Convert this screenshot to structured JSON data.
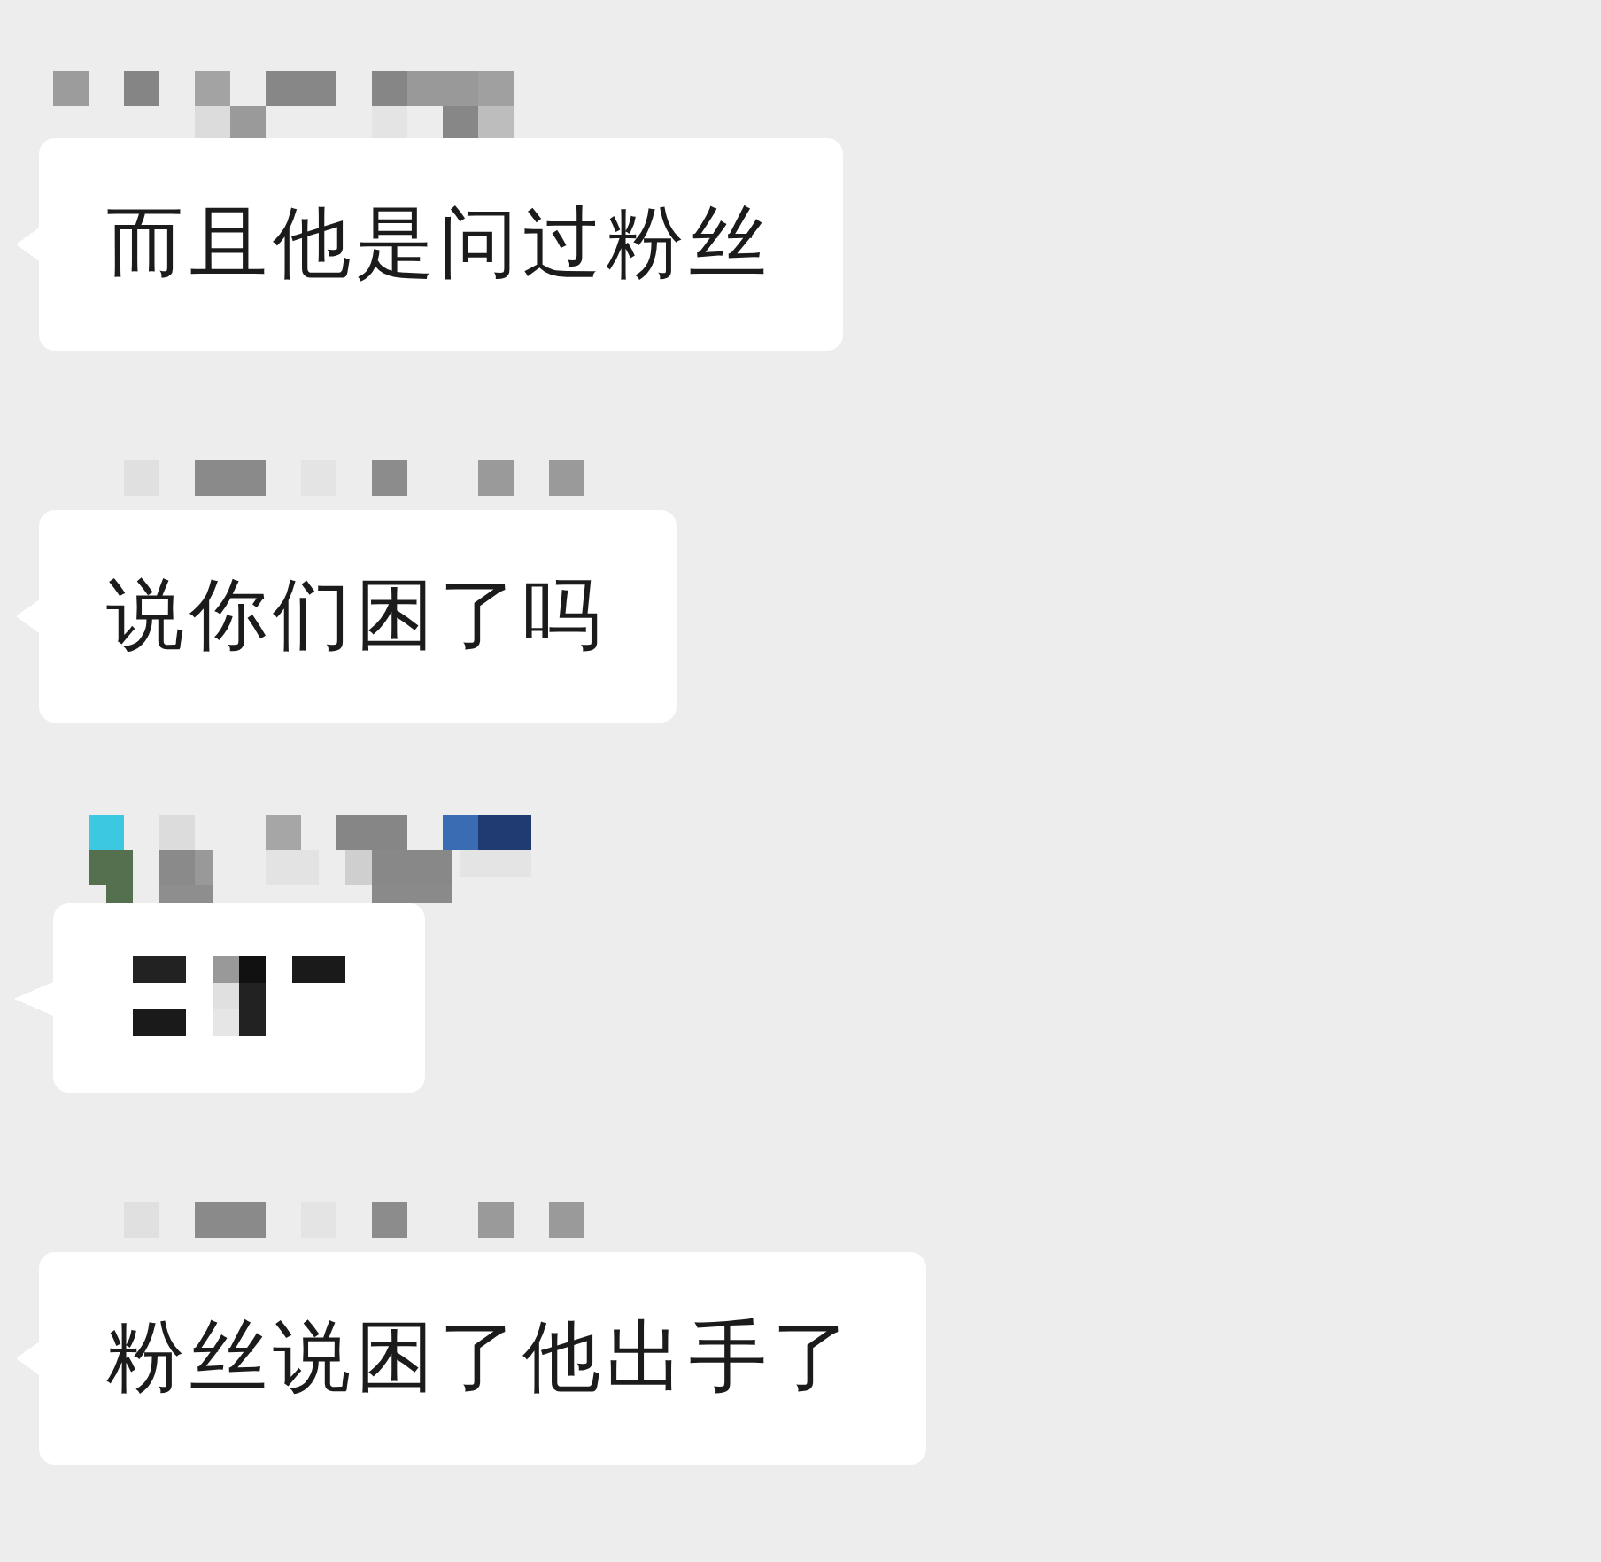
{
  "messages": [
    {
      "kind": "text",
      "text": "而且他是问过粉丝"
    },
    {
      "kind": "text",
      "text": "说你们困了吗"
    },
    {
      "kind": "pixelated"
    },
    {
      "kind": "text",
      "text": "粉丝说困了他出手了"
    }
  ]
}
